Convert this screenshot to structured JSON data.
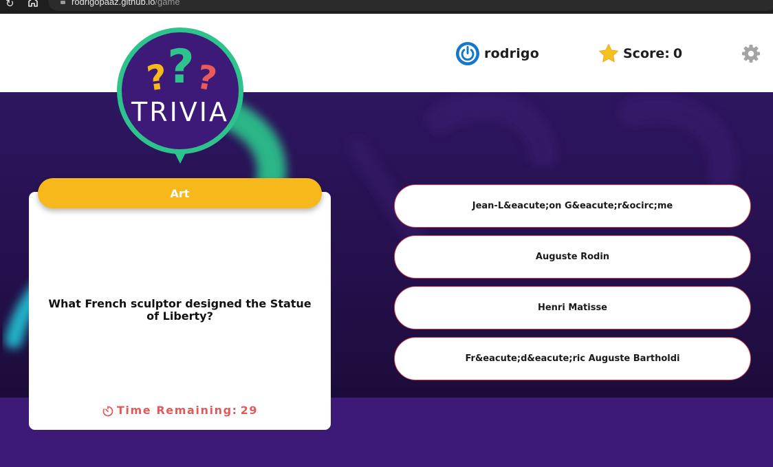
{
  "browser": {
    "url_host": "rodrigopaaz.github.io",
    "url_path": "/game"
  },
  "header": {
    "username": "rodrigo",
    "score_label": "Score:",
    "score_value": "0"
  },
  "logo": {
    "text": "TRIVIA"
  },
  "question": {
    "category": "Art",
    "text": "What French sculptor designed the Statue of Liberty?",
    "timer_label": "Time Remaining:",
    "timer_value": "29"
  },
  "answers": [
    {
      "label": "Jean-L&eacute;on G&eacute;r&ocirc;me"
    },
    {
      "label": "Auguste Rodin"
    },
    {
      "label": "Henri Matisse"
    },
    {
      "label": "Fr&eacute;d&eacute;ric Auguste Bartholdi"
    }
  ],
  "icons": {
    "power": "power-icon",
    "star": "star-icon",
    "gear": "gear-icon",
    "timer": "timer-icon",
    "reload": "reload-icon",
    "home": "home-icon",
    "lock": "lock-icon"
  },
  "colors": {
    "purple": "#3d1a78",
    "logo_green": "#2ec28c",
    "category_yellow": "#f7b81b",
    "timer_red": "#e05a5a",
    "answer_border": "#c9434b",
    "power_blue": "#1577c8"
  }
}
